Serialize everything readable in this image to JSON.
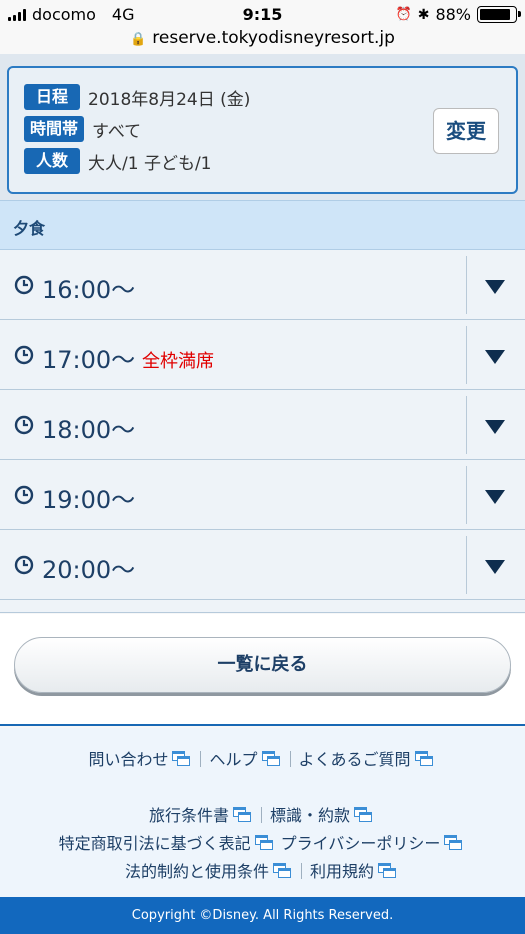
{
  "status_bar": {
    "carrier": "docomo",
    "network": "4G",
    "time": "9:15",
    "battery": "88%",
    "battery_level": 0.88
  },
  "browser": {
    "url": "reserve.tokyodisneyresort.jp"
  },
  "summary": {
    "date_label": "日程",
    "date_value": "2018年8月24日 (金)",
    "timeslot_label": "時間帯",
    "timeslot_value": "すべて",
    "people_label": "人数",
    "people_value": "大人/1 子ども/1",
    "change_button": "変更"
  },
  "section": {
    "title": "夕食"
  },
  "time_slots": [
    {
      "time": "16:00～",
      "status": ""
    },
    {
      "time": "17:00～",
      "status": "全枠満席"
    },
    {
      "time": "18:00～",
      "status": ""
    },
    {
      "time": "19:00～",
      "status": ""
    },
    {
      "time": "20:00～",
      "status": ""
    }
  ],
  "back_button": "一覧に戻る",
  "footer": {
    "links_row1": [
      "問い合わせ",
      "ヘルプ",
      "よくあるご質問"
    ],
    "links_row2": [
      "旅行条件書",
      "標識・約款"
    ],
    "links_row3": [
      "特定商取引法に基づく表記",
      "プライバシーポリシー"
    ],
    "links_row4": [
      "法的制約と使用条件",
      "利用規約"
    ],
    "copyright": "Copyright ©Disney. All Rights Reserved."
  },
  "colors": {
    "accent": "#1868b4",
    "sold_out": "#e00000",
    "text_dark": "#1d3f66"
  }
}
